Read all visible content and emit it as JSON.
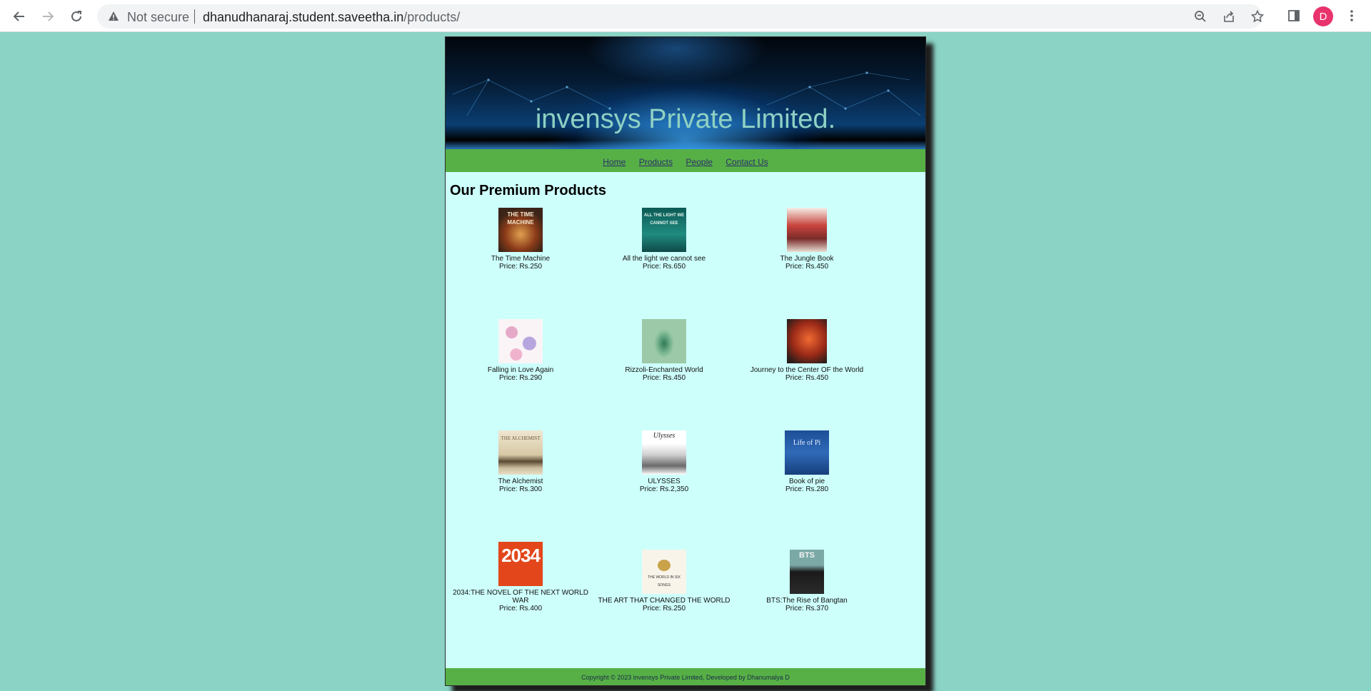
{
  "browser": {
    "security_label": "Not secure",
    "url_host": "dhanudhanaraj.student.saveetha.in",
    "url_path": "/products/",
    "avatar_letter": "D"
  },
  "site": {
    "banner_title": "invensys Private Limited.",
    "menu": [
      "Home",
      "Products",
      "People",
      "Contact Us"
    ],
    "heading": "Our Premium Products",
    "footer": "Copyright © 2023 invensys Private Limited, Developed by Dhanumalya D"
  },
  "products": [
    {
      "name": "The Time Machine",
      "price": "Price: Rs.250",
      "cover_text": "THE TIME MACHINE"
    },
    {
      "name": "All the light we cannot see",
      "price": "Price: Rs.650",
      "cover_text": "ALL THE LIGHT WE CANNOT SEE"
    },
    {
      "name": "The Jungle Book",
      "price": "Price: Rs.450",
      "cover_text": ""
    },
    {
      "name": "Falling in Love Again",
      "price": "Price: Rs.290",
      "cover_text": ""
    },
    {
      "name": "Rizzoli-Enchanted World",
      "price": "Price: Rs.450",
      "cover_text": ""
    },
    {
      "name": "Journey to the Center OF the World",
      "price": "Price: Rs.450",
      "cover_text": ""
    },
    {
      "name": "The Alchemist",
      "price": "Price: Rs.300",
      "cover_text": "THE ALCHEMIST"
    },
    {
      "name": "ULYSSES",
      "price": "Price: Rs.2,350",
      "cover_text": "Ulysses"
    },
    {
      "name": "Book of pie",
      "price": "Price: Rs.280",
      "cover_text": "Life of Pi"
    },
    {
      "name": "2034:THE NOVEL OF THE NEXT WORLD WAR",
      "price": "Price: Rs.400",
      "cover_text": "2034"
    },
    {
      "name": "THE ART THAT CHANGED THE WORLD",
      "price": "Price: Rs.250",
      "cover_text": "THE WORLD IN SIX SONGS"
    },
    {
      "name": "BTS:The Rise of Bangtan",
      "price": "Price: Rs.370",
      "cover_text": "BTS"
    }
  ]
}
